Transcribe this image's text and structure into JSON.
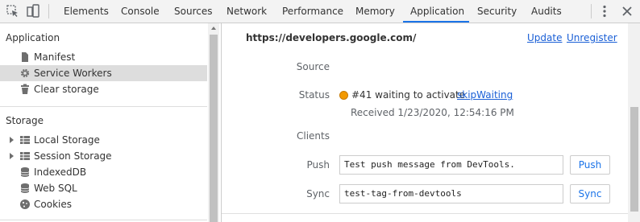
{
  "toolbar": {
    "icons": [
      "inspect-icon",
      "device-toolbar-icon",
      "more-icon",
      "close-icon"
    ],
    "tabs": [
      {
        "label": "Elements"
      },
      {
        "label": "Console"
      },
      {
        "label": "Sources"
      },
      {
        "label": "Network"
      },
      {
        "label": "Performance"
      },
      {
        "label": "Memory"
      },
      {
        "label": "Application"
      },
      {
        "label": "Security"
      },
      {
        "label": "Audits"
      }
    ],
    "active_tab": "Application",
    "accent_color": "#1a73e8"
  },
  "sidebar": {
    "application_heading": "Application",
    "application_items": [
      {
        "label": "Manifest",
        "icon": "file-icon"
      },
      {
        "label": "Service Workers",
        "icon": "gear-icon",
        "selected": true
      },
      {
        "label": "Clear storage",
        "icon": "trash-icon"
      }
    ],
    "storage_heading": "Storage",
    "storage_items": [
      {
        "label": "Local Storage",
        "icon": "grid-icon",
        "expandable": true
      },
      {
        "label": "Session Storage",
        "icon": "grid-icon",
        "expandable": true
      },
      {
        "label": "IndexedDB",
        "icon": "database-icon"
      },
      {
        "label": "Web SQL",
        "icon": "database-icon"
      },
      {
        "label": "Cookies",
        "icon": "cookie-icon"
      }
    ]
  },
  "main": {
    "origin": "https://developers.google.com/",
    "update_label": "Update",
    "unregister_label": "Unregister",
    "source_label": "Source",
    "status_label": "Status",
    "status_text": "#41 waiting to activate",
    "status_color": "#f29900",
    "skip_waiting_label": "skipWaiting",
    "received": "Received 1/23/2020, 12:54:16 PM",
    "clients_label": "Clients",
    "push_label": "Push",
    "push_value": "Test push message from DevTools.",
    "push_button": "Push",
    "sync_label": "Sync",
    "sync_value": "test-tag-from-devtools",
    "sync_button": "Sync"
  }
}
